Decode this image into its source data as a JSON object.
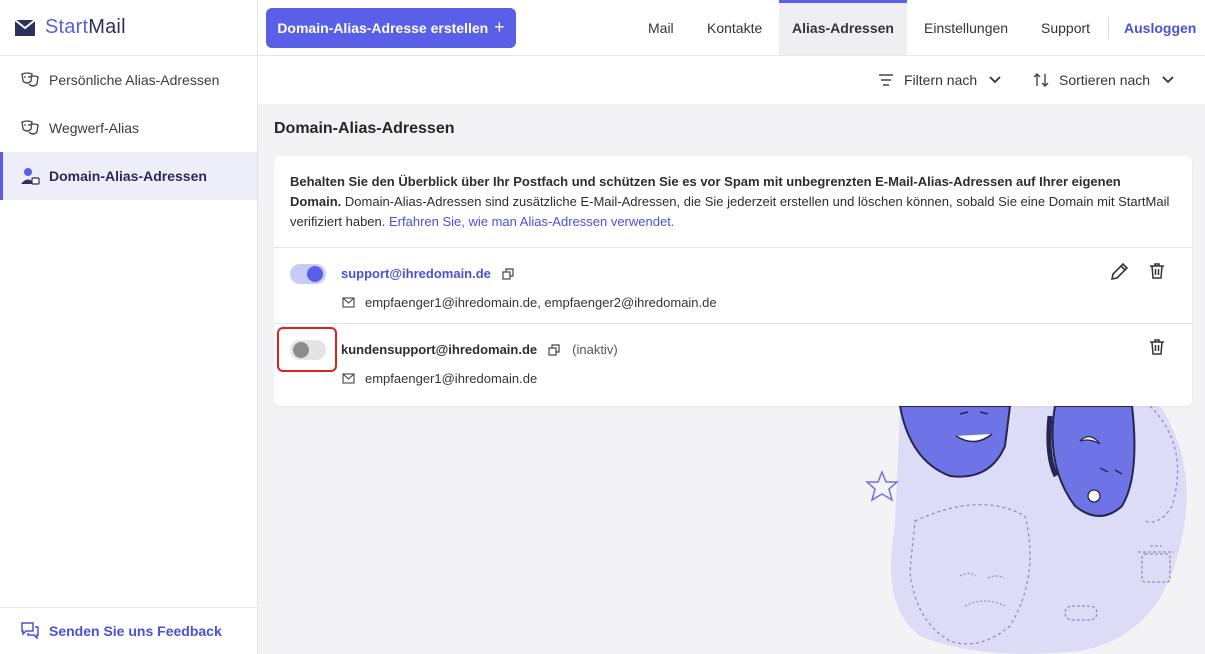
{
  "app": {
    "brand_start": "Start",
    "brand_mail": "Mail",
    "accent_color": "#5a5fe8"
  },
  "sidebar": {
    "items": [
      {
        "label": "Persönliche Alias-Adressen",
        "icon": "masks-icon"
      },
      {
        "label": "Wegwerf-Alias",
        "icon": "masks-icon"
      },
      {
        "label": "Domain-Alias-Adressen",
        "icon": "user-badge-icon",
        "active": true
      }
    ],
    "feedback_label": "Senden Sie uns Feedback"
  },
  "header": {
    "create_button": "Domain-Alias-Adresse erstellen",
    "create_plus": "+",
    "nav": [
      {
        "label": "Mail"
      },
      {
        "label": "Kontakte"
      },
      {
        "label": "Alias-Adressen",
        "active": true
      },
      {
        "label": "Einstellungen"
      },
      {
        "label": "Support"
      }
    ],
    "logout": "Ausloggen"
  },
  "toolbar": {
    "filter_label": "Filtern nach",
    "sort_label": "Sortieren nach"
  },
  "main": {
    "title": "Domain-Alias-Adressen",
    "intro_bold": "Behalten Sie den Überblick über Ihr Postfach und schützen Sie es vor Spam mit unbegrenzten E-Mail-Alias-Adressen auf Ihrer eigenen Domain.",
    "intro_text": " Domain-Alias-Adressen sind zusätzliche E-Mail-Adressen, die Sie jederzeit erstellen und löschen können, sobald Sie eine Domain mit StartMail verifiziert haben. ",
    "intro_link": "Erfahren Sie, wie man Alias-Adressen verwendet.",
    "aliases": [
      {
        "address": "support@ihredomain.de",
        "enabled": true,
        "status": "",
        "recipients": "empfaenger1@ihredomain.de, empfaenger2@ihredomain.de"
      },
      {
        "address": "kundensupport@ihredomain.de",
        "enabled": false,
        "status": "(inaktiv)",
        "recipients": "empfaenger1@ihredomain.de"
      }
    ]
  }
}
